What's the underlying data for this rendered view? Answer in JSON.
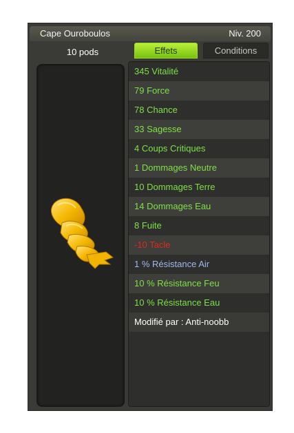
{
  "item": {
    "name": "Cape Ouroboulos",
    "level": "Niv. 200",
    "weight": "10 pods"
  },
  "tabs": {
    "effects_label": "Effets",
    "conditions_label": "Conditions"
  },
  "effects": [
    {
      "text": "345 Vitalité",
      "color": "green"
    },
    {
      "text": "79 Force",
      "color": "green"
    },
    {
      "text": "78 Chance",
      "color": "green"
    },
    {
      "text": "33 Sagesse",
      "color": "green"
    },
    {
      "text": "4 Coups Critiques",
      "color": "green"
    },
    {
      "text": "1 Dommages Neutre",
      "color": "green"
    },
    {
      "text": "10 Dommages Terre",
      "color": "green"
    },
    {
      "text": "14 Dommages Eau",
      "color": "green"
    },
    {
      "text": "8 Fuite",
      "color": "green"
    },
    {
      "text": "-10 Tacle",
      "color": "red"
    },
    {
      "text": "1 % Résistance Air",
      "color": "blue"
    },
    {
      "text": "10 % Résistance Feu",
      "color": "green"
    },
    {
      "text": "10 % Résistance Eau",
      "color": "green"
    }
  ],
  "modified_by": "Modifié par : Anti-noobb",
  "colors": {
    "bonus": "#7fe046",
    "malus": "#e02a1a",
    "neutral": "#9fb8ee",
    "active_tab": "#9ddc2a"
  },
  "item_icon": "golden-cape-icon"
}
